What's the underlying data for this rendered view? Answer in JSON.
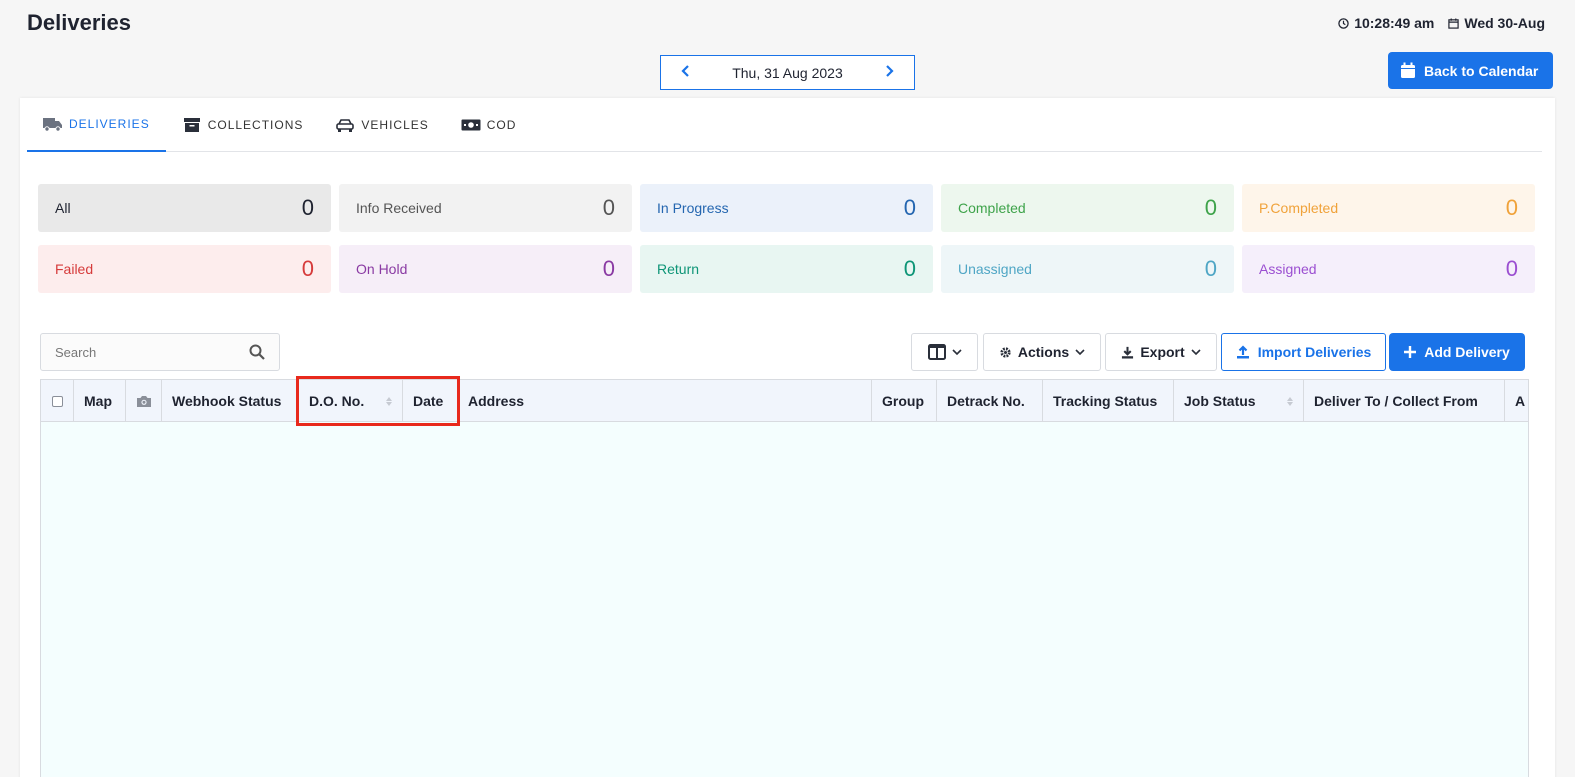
{
  "header": {
    "title": "Deliveries",
    "time": "10:28:49 am",
    "date": "Wed 30-Aug"
  },
  "date_nav": {
    "current_date": "Thu, 31 Aug 2023"
  },
  "back_to_calendar_label": "Back to Calendar",
  "tabs": [
    {
      "label": "DELIVERIES",
      "icon": "truck-icon",
      "active": true
    },
    {
      "label": "COLLECTIONS",
      "icon": "archive-icon",
      "active": false
    },
    {
      "label": "VEHICLES",
      "icon": "car-icon",
      "active": false
    },
    {
      "label": "COD",
      "icon": "cash-icon",
      "active": false
    }
  ],
  "stats": [
    {
      "label": "All",
      "count": "0",
      "bg": "#e9e9e9",
      "color": "#1f2330"
    },
    {
      "label": "Info Received",
      "count": "0",
      "bg": "#f2f2f2",
      "color": "#555555"
    },
    {
      "label": "In Progress",
      "count": "0",
      "bg": "#ebf1fa",
      "color": "#2466b0"
    },
    {
      "label": "Completed",
      "count": "0",
      "bg": "#edf7ee",
      "color": "#3ea34a"
    },
    {
      "label": "P.Completed",
      "count": "0",
      "bg": "#fef5ea",
      "color": "#f0a23a"
    },
    {
      "label": "Failed",
      "count": "0",
      "bg": "#fdeded",
      "color": "#d63b3b"
    },
    {
      "label": "On Hold",
      "count": "0",
      "bg": "#f6eef8",
      "color": "#8a3aa3"
    },
    {
      "label": "Return",
      "count": "0",
      "bg": "#e8f6f2",
      "color": "#0e9577"
    },
    {
      "label": "Unassigned",
      "count": "0",
      "bg": "#eef6f8",
      "color": "#4fa6c5"
    },
    {
      "label": "Assigned",
      "count": "0",
      "bg": "#f5effb",
      "color": "#9b4fd1"
    }
  ],
  "search": {
    "placeholder": "Search"
  },
  "toolbar": {
    "actions_label": "Actions",
    "export_label": "Export",
    "import_label": "Import Deliveries",
    "add_label": "Add Delivery"
  },
  "table": {
    "columns": [
      "Map",
      "Webhook Status",
      "D.O. No.",
      "Date",
      "Address",
      "Group",
      "Detrack No.",
      "Tracking Status",
      "Job Status",
      "Deliver To / Collect From",
      "A"
    ]
  },
  "colors": {
    "accent": "#1a73e8",
    "highlight": "#e8291c"
  }
}
